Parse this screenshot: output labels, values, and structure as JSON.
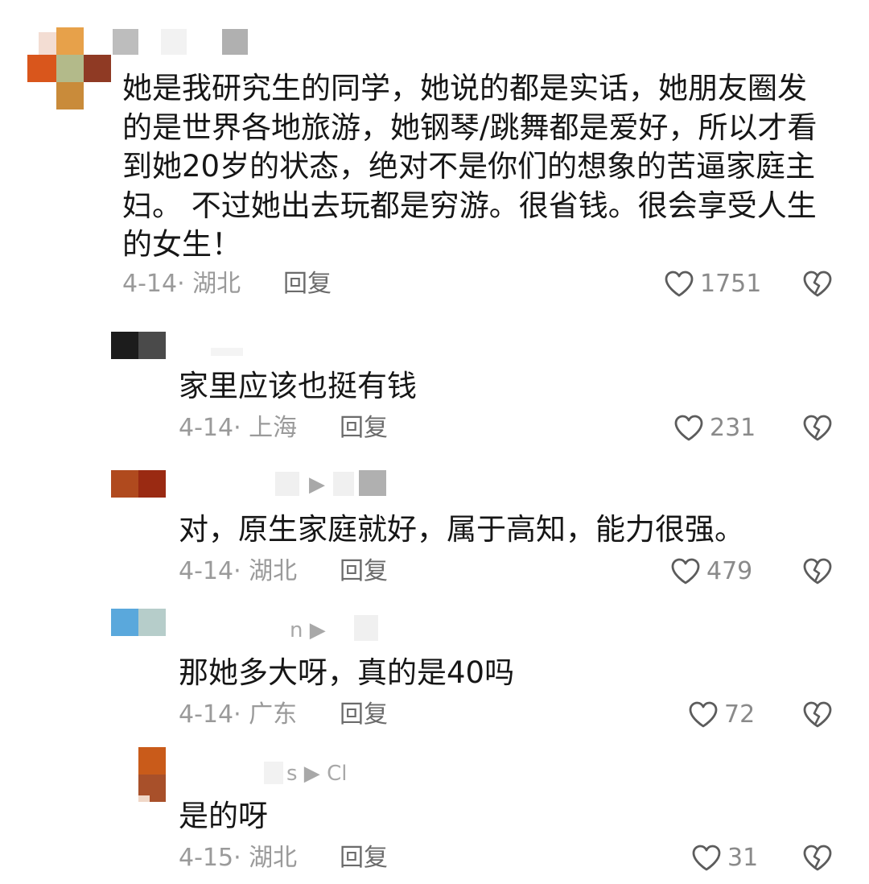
{
  "comments": [
    {
      "text": "她是我研究生的同学，她说的都是实话，她朋友圈发的是世界各地旅游，她钢琴/跳舞都是爱好，所以才看到她20岁的状态，绝对不是你们的想象的苦逼家庭主妇。 不过她出去玩都是穷游。很省钱。很会享受人生的女生！",
      "date": "4-14",
      "location": "湖北",
      "reply_label": "回复",
      "likes": "1751"
    },
    {
      "text": "家里应该也挺有钱",
      "date": "4-14",
      "location": "上海",
      "reply_label": "回复",
      "likes": "231"
    },
    {
      "text": "对，原生家庭就好，属于高知，能力很强。",
      "date": "4-14",
      "location": "湖北",
      "reply_label": "回复",
      "likes": "479",
      "name_fragment": "▶"
    },
    {
      "text": "那她多大呀，真的是40吗",
      "date": "4-14",
      "location": "广东",
      "reply_label": "回复",
      "likes": "72",
      "name_fragment": "n ▶"
    },
    {
      "text": "是的呀",
      "date": "4-15",
      "location": "湖北",
      "reply_label": "回复",
      "likes": "31",
      "name_fragment": "s ▶ Cl"
    }
  ],
  "colors": {
    "heart_stroke": "#5c5c5c",
    "meta_text": "#9a9a9a",
    "reply_text": "#6b6b6b"
  },
  "icons": {
    "like": "heart-outline-icon",
    "dislike": "broken-heart-icon"
  }
}
